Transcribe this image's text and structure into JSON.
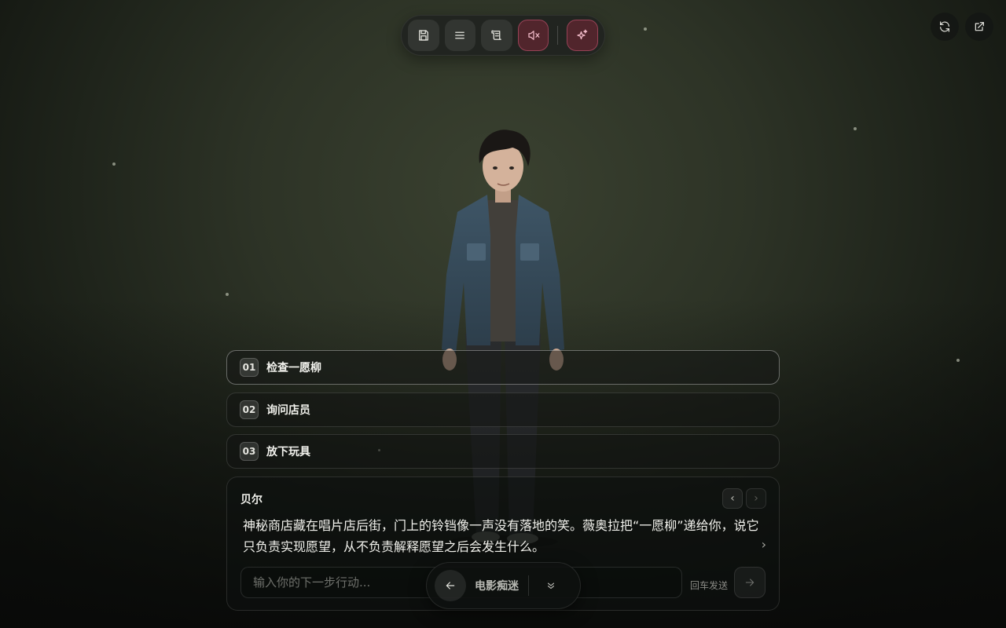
{
  "toolbar": {
    "buttons": [
      {
        "icon": "save-icon"
      },
      {
        "icon": "menu-icon"
      },
      {
        "icon": "script-icon"
      },
      {
        "icon": "mute-icon"
      },
      {
        "icon": "sparkles-icon"
      }
    ]
  },
  "corner": {
    "refresh_icon": "refresh-icon",
    "external_icon": "external-link-icon"
  },
  "choices": [
    {
      "num": "01",
      "label": "检查一愿柳"
    },
    {
      "num": "02",
      "label": "询问店员"
    },
    {
      "num": "03",
      "label": "放下玩具"
    }
  ],
  "dialog": {
    "speaker": "贝尔",
    "text": "神秘商店藏在唱片店后街，门上的铃铛像一声没有落地的笑。薇奥拉把“一愿柳”递给你，说它只负责实现愿望，从不负责解释愿望之后会发生什么。",
    "prev_label": "‹",
    "next_label": "›",
    "more_label": "›",
    "input_placeholder": "输入你的下一步行动...",
    "input_value": "",
    "hint": "回车发送"
  },
  "pill": {
    "title": "电影痴迷"
  },
  "colors": {
    "accent_danger": "#8c283c",
    "background": "#2d3326"
  }
}
